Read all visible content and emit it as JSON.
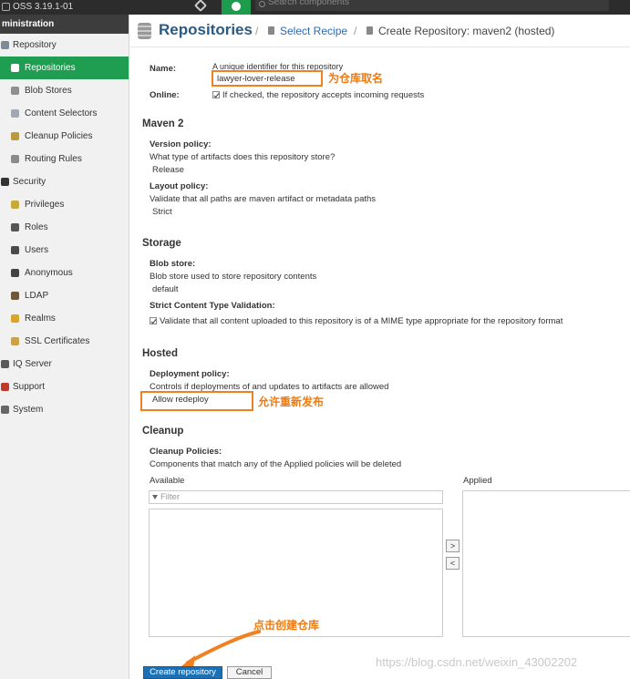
{
  "topbar": {
    "version": "OSS 3.19.1-01",
    "search_placeholder": "Search components"
  },
  "sidebar": {
    "section_title": "ministration",
    "items": [
      {
        "label": "Repository",
        "level": 1,
        "icon": "repository-icon",
        "active": false
      },
      {
        "label": "Repositories",
        "level": 2,
        "icon": "repositories-icon",
        "active": true
      },
      {
        "label": "Blob Stores",
        "level": 2,
        "icon": "blob-stores-icon",
        "active": false
      },
      {
        "label": "Content Selectors",
        "level": 2,
        "icon": "content-selectors-icon",
        "active": false
      },
      {
        "label": "Cleanup Policies",
        "level": 2,
        "icon": "cleanup-policies-icon",
        "active": false
      },
      {
        "label": "Routing Rules",
        "level": 2,
        "icon": "routing-rules-icon",
        "active": false
      },
      {
        "label": "Security",
        "level": 1,
        "icon": "security-icon",
        "active": false
      },
      {
        "label": "Privileges",
        "level": 2,
        "icon": "privileges-icon",
        "active": false
      },
      {
        "label": "Roles",
        "level": 2,
        "icon": "roles-icon",
        "active": false
      },
      {
        "label": "Users",
        "level": 2,
        "icon": "users-icon",
        "active": false
      },
      {
        "label": "Anonymous",
        "level": 2,
        "icon": "anonymous-icon",
        "active": false
      },
      {
        "label": "LDAP",
        "level": 2,
        "icon": "ldap-icon",
        "active": false
      },
      {
        "label": "Realms",
        "level": 2,
        "icon": "realms-icon",
        "active": false
      },
      {
        "label": "SSL Certificates",
        "level": 2,
        "icon": "ssl-certificates-icon",
        "active": false
      },
      {
        "label": "IQ Server",
        "level": 1,
        "icon": "iq-server-icon",
        "active": false
      },
      {
        "label": "Support",
        "level": 1,
        "icon": "support-icon",
        "active": false
      },
      {
        "label": "System",
        "level": 1,
        "icon": "system-icon",
        "active": false
      }
    ]
  },
  "header": {
    "title": "Repositories",
    "separator": "/",
    "crumb_select_recipe": "Select Recipe",
    "crumb_create": "Create Repository: maven2 (hosted)"
  },
  "form": {
    "name_label": "Name:",
    "name_help": "A unique identifier for this repository",
    "name_value": "lawyer-lover-release",
    "online_label": "Online:",
    "online_text": "If checked, the repository accepts incoming requests",
    "maven_section": "Maven 2",
    "version_policy_label": "Version policy:",
    "version_policy_help": "What type of artifacts does this repository store?",
    "version_policy_value": "Release",
    "layout_policy_label": "Layout policy:",
    "layout_policy_help": "Validate that all paths are maven artifact or metadata paths",
    "layout_policy_value": "Strict",
    "storage_section": "Storage",
    "blob_store_label": "Blob store:",
    "blob_store_help": "Blob store used to store repository contents",
    "blob_store_value": "default",
    "strict_label": "Strict Content Type Validation:",
    "strict_text": "Validate that all content uploaded to this repository is of a MIME type appropriate for the repository format",
    "hosted_section": "Hosted",
    "deployment_label": "Deployment policy:",
    "deployment_help": "Controls if deployments of and updates to artifacts are allowed",
    "deployment_value": "Allow redeploy",
    "cleanup_section": "Cleanup",
    "cleanup_label": "Cleanup Policies:",
    "cleanup_help": "Components that match any of the Applied policies will be deleted",
    "available_label": "Available",
    "applied_label": "Applied",
    "filter_placeholder": "Filter",
    "move_right": ">",
    "move_left": "<",
    "create_button": "Create repository",
    "cancel_button": "Cancel"
  },
  "annotations": {
    "name_note": "为仓库取名",
    "redeploy_note": "允许重新发布",
    "create_note": "点击创建仓库",
    "highlight_color": "#f08020"
  },
  "watermark": "https://blog.csdn.net/weixin_43002202"
}
